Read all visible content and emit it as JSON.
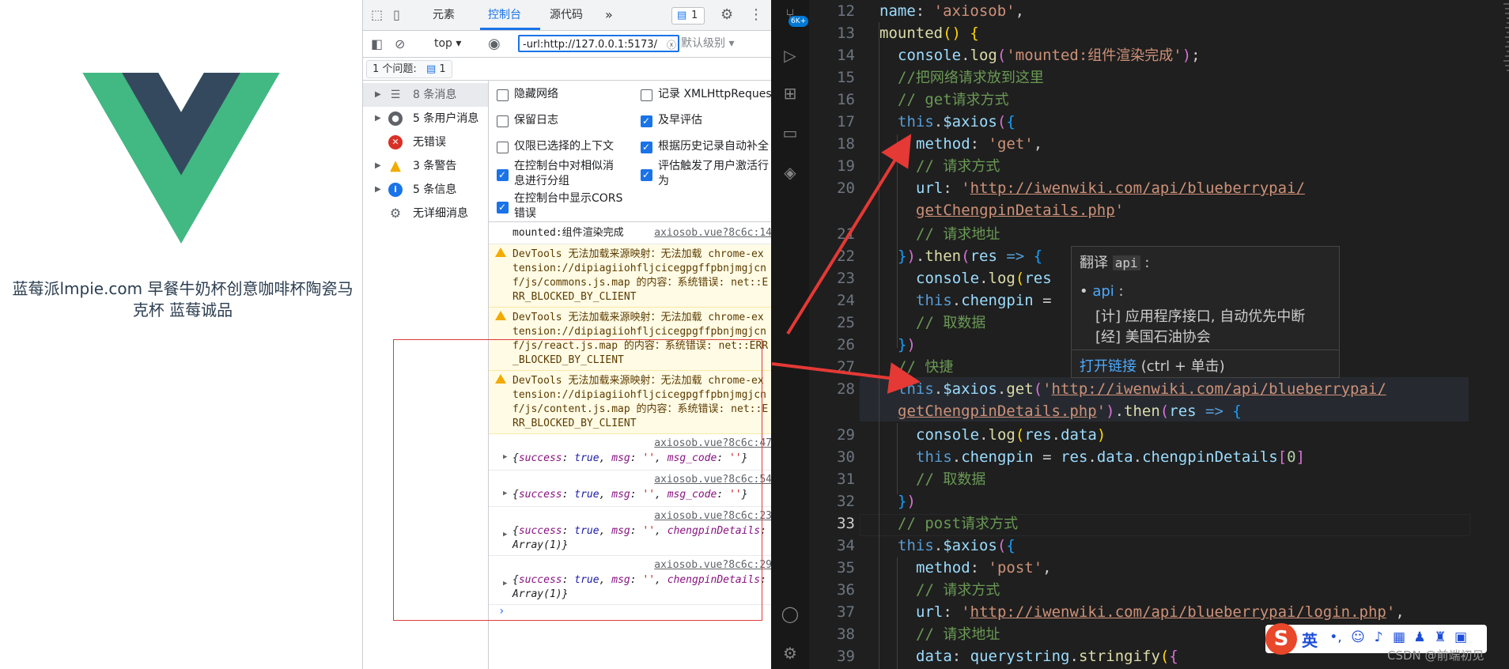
{
  "page": {
    "title": "蓝莓派lmpie.com 早餐牛奶杯创意咖啡杯陶瓷马克杯 蓝莓诚品"
  },
  "devtools": {
    "tabs": [
      "元素",
      "控制台",
      "源代码"
    ],
    "more": "»",
    "issue_count": "1",
    "context": "top ▾",
    "filter_value": "-url:http://127.0.0.1:5173/",
    "level": "默认级别 ▾",
    "issues_text": "1 个问题:",
    "issues_count": "1",
    "sidebar": [
      {
        "label": "8 条消息",
        "icon": "list-icon"
      },
      {
        "label": "5 条用户消息",
        "icon": "user-icon"
      },
      {
        "label": "无错误",
        "icon": "error-icon"
      },
      {
        "label": "3 条警告",
        "icon": "warning-icon"
      },
      {
        "label": "5 条信息",
        "icon": "info-icon"
      },
      {
        "label": "无详细消息",
        "icon": "gear-icon"
      }
    ],
    "settings_left": [
      "隐藏网络",
      "保留日志",
      "仅限已选择的上下文",
      "在控制台中对相似消息进行分组",
      "在控制台中显示CORS错误"
    ],
    "settings_right": [
      "记录 XMLHttpRequests",
      "及早评估",
      "根据历史记录自动补全",
      "评估触发了用户激活行为"
    ],
    "messages": {
      "m1_text": "mounted:组件渲染完成",
      "m1_src": "axiosob.vue?8c6c:14",
      "w1": "DevTools 无法加载来源映射：无法加载 chrome-extension://dipiagiiohfljcicegpgffpbnjmgjcnf/js/commons.js.map 的内容：系统错误: net::ERR_BLOCKED_BY_CLIENT",
      "w2": "DevTools 无法加载来源映射：无法加载 chrome-extension://dipiagiiohfljcicegpgffpbnjmgjcnf/js/react.js.map 的内容：系统错误: net::ERR_BLOCKED_BY_CLIENT",
      "w3": "DevTools 无法加载来源映射：无法加载 chrome-extension://dipiagiiohfljcicegpgffpbnjmgjcnf/js/content.js.map 的内容：系统错误: net::ERR_BLOCKED_BY_CLIENT",
      "o1_src": "axiosob.vue?8c6c:47",
      "o2_src": "axiosob.vue?8c6c:54",
      "o3_src": "axiosob.vue?8c6c:23",
      "o4_src": "axiosob.vue?8c6c:29"
    }
  },
  "vscode": {
    "badge": "6K+",
    "lines": [
      "12",
      "13",
      "14",
      "15",
      "16",
      "17",
      "18",
      "19",
      "20",
      "21",
      "22",
      "23",
      "24",
      "25",
      "26",
      "27",
      "28",
      "29",
      "30",
      "31",
      "32",
      "33",
      "34",
      "35",
      "36",
      "37",
      "38",
      "39"
    ],
    "hover": {
      "title": "翻译",
      "word": "api",
      "bullet": "api",
      "def1": "[计] 应用程序接口, 自动优先中断",
      "def2": "[经] 美国石油协会",
      "link": "打开链接",
      "hint": "(ctrl + 单击)"
    },
    "ime_lang": "英",
    "watermark": "CSDN @前端初见"
  },
  "colors": {
    "vue_green": "#42b883",
    "vue_dark": "#35495e",
    "accent": "#1a73e8",
    "arrow_red": "#e53935"
  }
}
